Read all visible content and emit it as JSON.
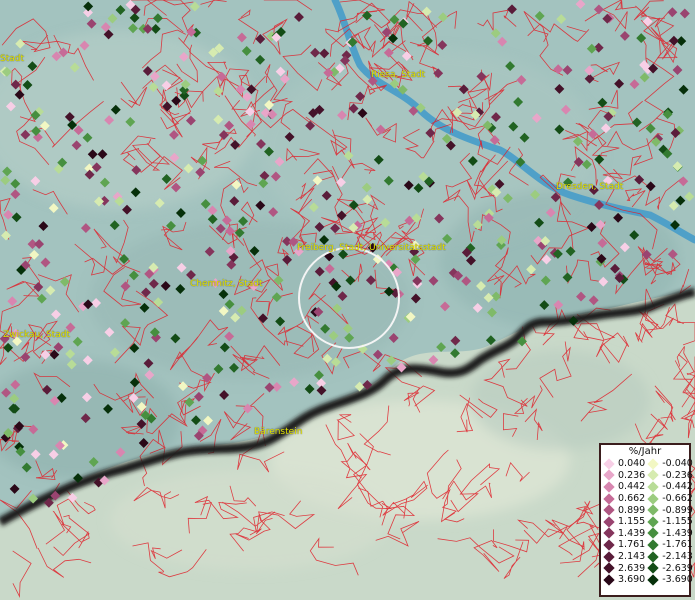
{
  "cities": [
    {
      "id": "riesa",
      "name": "Riesa, Stadt"
    },
    {
      "id": "dresden",
      "name": "Dresden, Stadt"
    },
    {
      "id": "freiberg",
      "name": "Freiberg, Stadt, Universitätsstadt"
    },
    {
      "id": "chemnitz",
      "name": "Chemnitz, Stadt"
    },
    {
      "id": "zwickau",
      "name": "Zwickau, Stadt"
    },
    {
      "id": "baerenstein",
      "name": "Bärenstein"
    },
    {
      "id": "west-edge",
      "name": "Stadt"
    }
  ],
  "legend": {
    "title": "%/Jahr",
    "positive": [
      {
        "label": "0.040",
        "color": "#f7cfe6"
      },
      {
        "label": "0.236",
        "color": "#e8a6c9"
      },
      {
        "label": "0.442",
        "color": "#d886b0"
      },
      {
        "label": "0.662",
        "color": "#c66b97"
      },
      {
        "label": "0.899",
        "color": "#b05682"
      },
      {
        "label": "1.155",
        "color": "#9a4470"
      },
      {
        "label": "1.439",
        "color": "#85355c"
      },
      {
        "label": "1.761",
        "color": "#6f284a"
      },
      {
        "label": "2.143",
        "color": "#5a1c3a"
      },
      {
        "label": "2.639",
        "color": "#441229"
      },
      {
        "label": "3.690",
        "color": "#2a0818"
      }
    ],
    "negative": [
      {
        "label": "-0.040",
        "color": "#f2f7c3"
      },
      {
        "label": "-0.236",
        "color": "#d6ebb0"
      },
      {
        "label": "-0.442",
        "color": "#b8dc97"
      },
      {
        "label": "-0.662",
        "color": "#9ccc80"
      },
      {
        "label": "-0.899",
        "color": "#7fba69"
      },
      {
        "label": "-1.155",
        "color": "#5fa552"
      },
      {
        "label": "-1.439",
        "color": "#468f3f"
      },
      {
        "label": "-1.761",
        "color": "#327a30"
      },
      {
        "label": "-2.143",
        "color": "#216322"
      },
      {
        "label": "-2.639",
        "color": "#134c16"
      },
      {
        "label": "-3.690",
        "color": "#06300a"
      }
    ]
  }
}
